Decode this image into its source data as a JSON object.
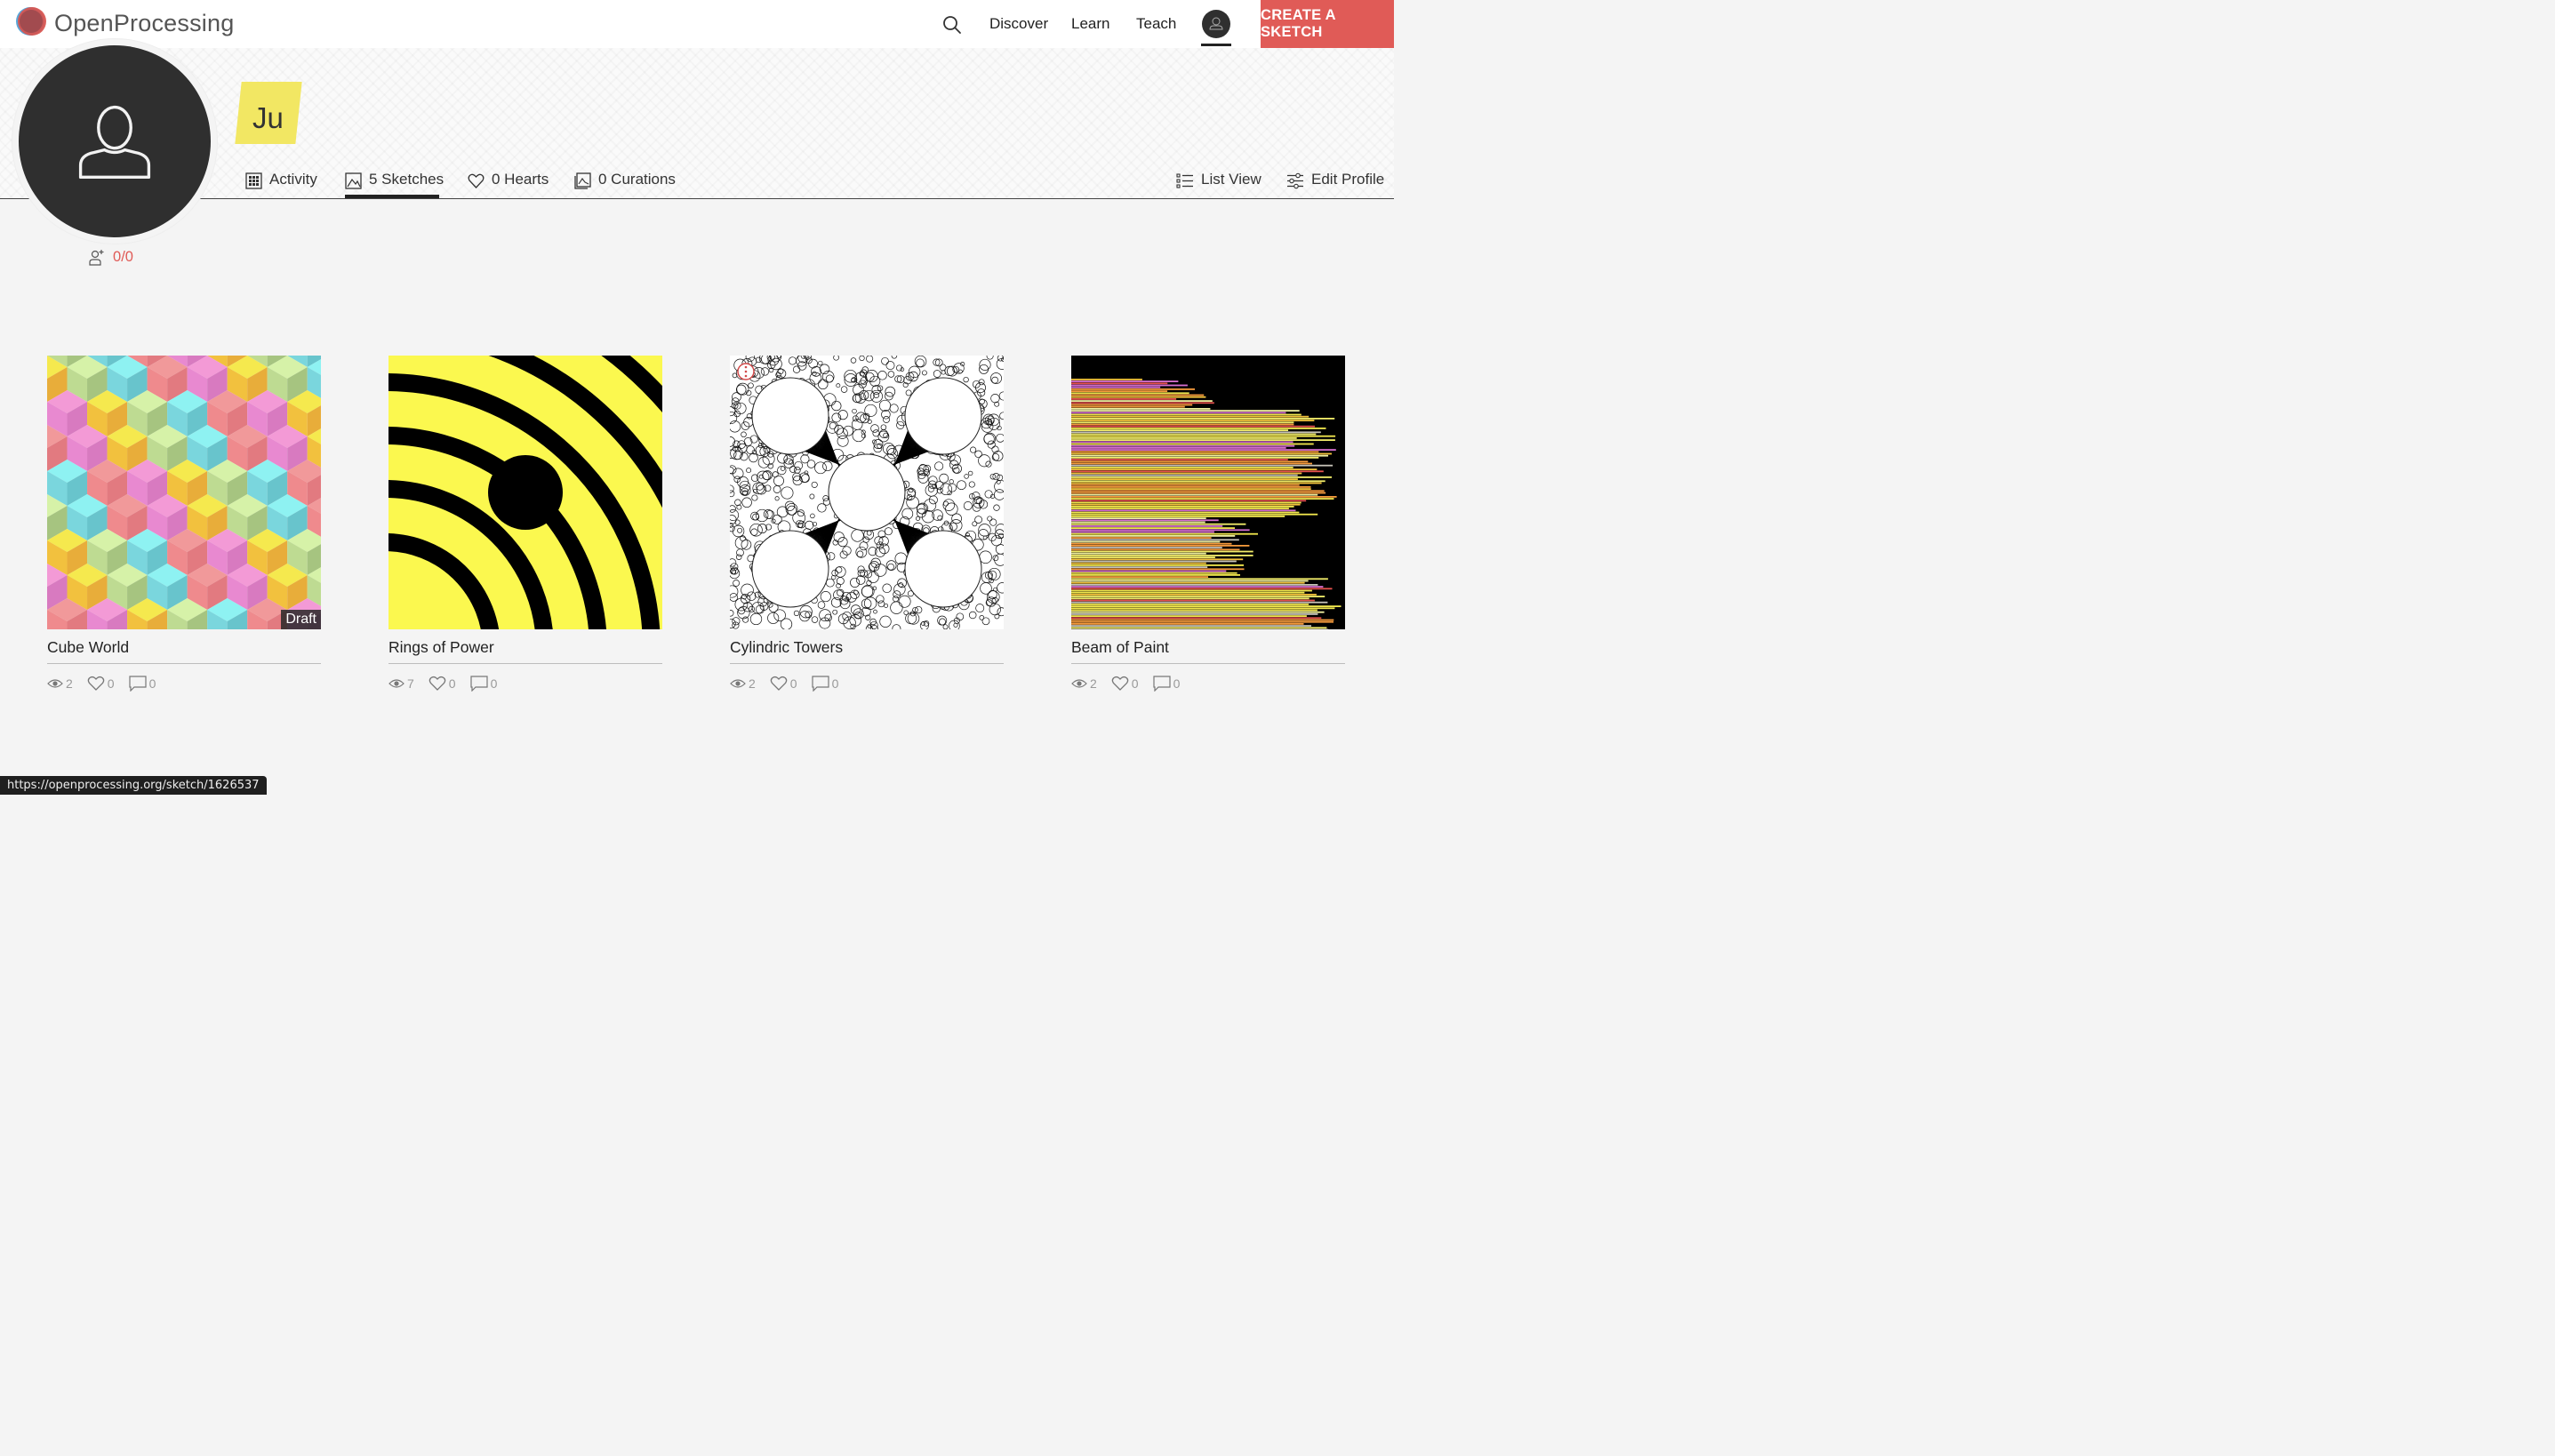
{
  "app": {
    "brand": "OpenProcessing"
  },
  "nav": {
    "search_icon": "search-icon",
    "links": [
      "Discover",
      "Learn",
      "Teach"
    ],
    "create_label": "CREATE A SKETCH"
  },
  "profile": {
    "name": "Ju",
    "followers": "0",
    "following": "0",
    "follow_icon": "add-user-icon"
  },
  "tabs": {
    "activity": "Activity",
    "sketches": "5 Sketches",
    "hearts": "0 Hearts",
    "curations": "0 Curations",
    "list_view": "List View",
    "edit_profile": "Edit Profile",
    "active": "sketches"
  },
  "sketches": [
    {
      "title": "Cube World",
      "views": "2",
      "hearts": "0",
      "comments": "0",
      "badge": "Draft"
    },
    {
      "title": "Rings of Power",
      "views": "7",
      "hearts": "0",
      "comments": "0"
    },
    {
      "title": "Cylindric Towers",
      "views": "2",
      "hearts": "0",
      "comments": "0"
    },
    {
      "title": "Beam of Paint",
      "views": "2",
      "hearts": "0",
      "comments": "0"
    }
  ],
  "status_url": "https://openprocessing.org/sketch/1626537",
  "colors": {
    "accent": "#e05b57",
    "badge": "#f2e763",
    "dark": "#2f2f2f"
  }
}
